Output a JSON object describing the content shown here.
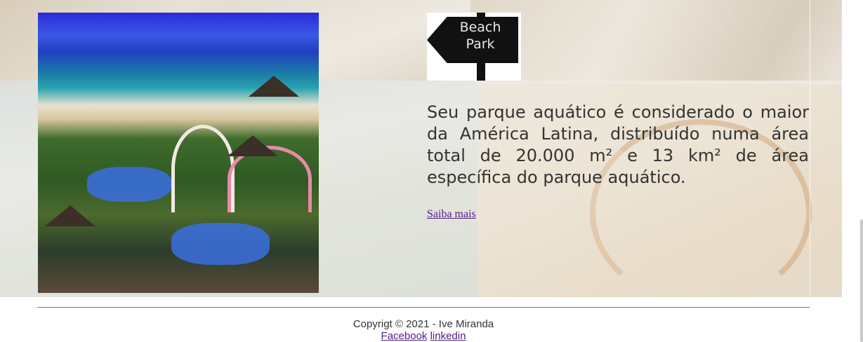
{
  "hero": {
    "photo_alt": "Beach Park",
    "sign_label_line1": "Beach",
    "sign_label_line2": "Park"
  },
  "content": {
    "description": "Seu parque aquático é considerado o maior da América Latina, distribuído numa área total de 20.000 m² e 13 km² de área específica do parque aquático.",
    "link_label": "Saiba mais"
  },
  "footer": {
    "copyright": "Copyrigt © 2021 - Ive Miranda",
    "links": [
      "Facebook",
      "linkedin"
    ]
  },
  "colors": {
    "text": "#333333",
    "link_visited": "#551a8b",
    "divider": "#777777"
  }
}
